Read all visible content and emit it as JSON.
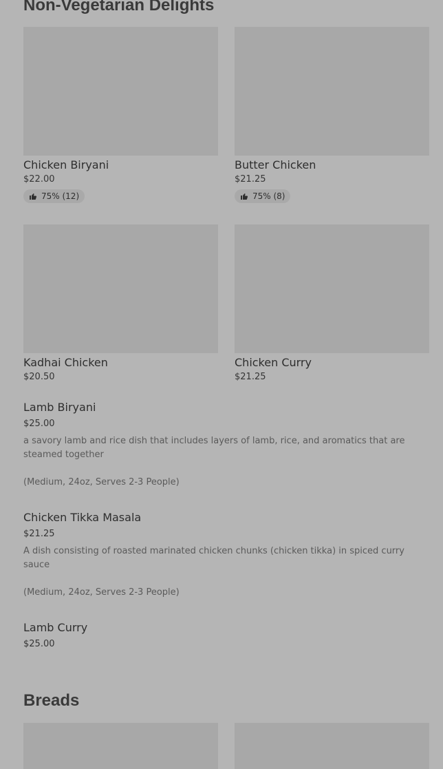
{
  "sections": {
    "nonveg_title": "Non-Vegetarian Delights",
    "breads_title": "Breads"
  },
  "cards": [
    {
      "name": "Chicken Biryani",
      "price": "$22.00",
      "rating": "75% (12)"
    },
    {
      "name": "Butter Chicken",
      "price": "$21.25",
      "rating": "75% (8)"
    },
    {
      "name": "Kadhai Chicken",
      "price": "$20.50"
    },
    {
      "name": "Chicken Curry",
      "price": "$21.25"
    }
  ],
  "list_items": [
    {
      "name": "Lamb Biryani",
      "price": "$25.00",
      "description": "a savory lamb and rice dish that includes layers of lamb, rice, and aromatics that are steamed together",
      "note": "(Medium, 24oz, Serves 2-3 People)"
    },
    {
      "name": "Chicken Tikka Masala",
      "price": "$21.25",
      "description": "A dish consisting of roasted marinated chicken chunks (chicken tikka) in spiced curry sauce",
      "note": "(Medium, 24oz, Serves 2-3 People)"
    },
    {
      "name": "Lamb Curry",
      "price": "$25.00"
    }
  ],
  "icons": {
    "rating": "thumbs-up-icon"
  },
  "colors": {
    "background": "#b5b5b5",
    "image_placeholder": "#a8a8a8",
    "pill": "#a9a9a9"
  }
}
